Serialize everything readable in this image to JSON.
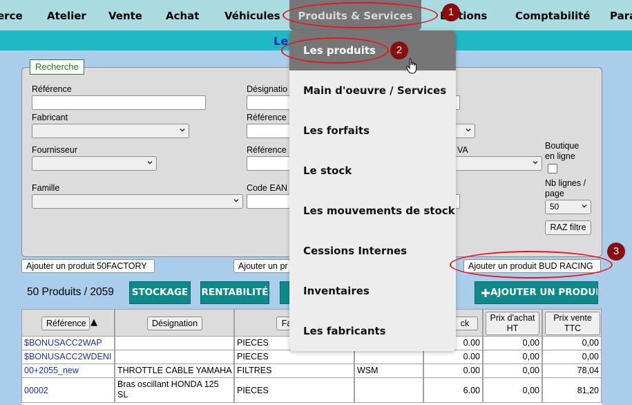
{
  "nav": {
    "items": [
      "erce",
      "Atelier",
      "Vente",
      "Achat",
      "Véhicules",
      "Produits & Services",
      "Éditions",
      "Comptabilité",
      "Para"
    ],
    "active": "Produits & Services"
  },
  "banner": {
    "title": "Le"
  },
  "dropdown": {
    "items": [
      "Les produits",
      "Main d'oeuvre / Services",
      "Les forfaits",
      "Le stock",
      "Les mouvements de stock",
      "Cessions Internes",
      "Inventaires",
      "Les fabricants"
    ],
    "highlighted": "Les produits"
  },
  "search": {
    "legend": "Recherche",
    "labels": {
      "reference": "Référence",
      "designation": "Désignatio",
      "fabricant": "Fabricant",
      "reference2": "Référence",
      "fournisseur": "Fournisseur",
      "reference3": "Référence",
      "tva": "VA",
      "famille": "Famille",
      "code_ean": "Code EAN",
      "boutique": "Boutique en ligne",
      "nb_lignes": "Nb lignes / page"
    },
    "nb_lignes_value": "50",
    "raz_label": "RAZ filtre"
  },
  "actions": {
    "add_50factory": "Ajouter un produit 50FACTORY",
    "add_partial": "Ajouter un pr",
    "add_bud_racing": "Ajouter un produit BUD RACING"
  },
  "toolbar": {
    "count": "50 Produits / 2059",
    "stockage": "STOCKAGE",
    "rentabilite": "RENTABILITÉ",
    "add_product": "AJOUTER UN PRODUIT"
  },
  "table": {
    "headers": {
      "reference": "Référence",
      "sort_indicator": "▲",
      "designation": "Désignation",
      "famille_partial": "Fa",
      "stock_partial": "ck",
      "prix_achat": "Prix d'achat HT",
      "prix_vente": "Prix vente TTC"
    },
    "rows": [
      {
        "ref": "$BONUSACC2WAP",
        "designation": "",
        "famille": "PIECES",
        "fabricant": "",
        "stock": "0.00",
        "achat": "0,00",
        "vente": "0,00"
      },
      {
        "ref": "$BONUSACC2WDENI",
        "designation": "",
        "famille": "PIECES",
        "fabricant": "",
        "stock": "0.00",
        "achat": "0,00",
        "vente": "0,00"
      },
      {
        "ref": "00+2055_new",
        "designation": "THROTTLE CABLE YAMAHA",
        "famille": "FILTRES",
        "fabricant": "WSM",
        "stock": "0.00",
        "achat": "0,00",
        "vente": "78,04"
      },
      {
        "ref": "00002",
        "designation": "Bras oscillant HONDA 125 SL",
        "famille": "PIECES",
        "fabricant": "",
        "stock": "6.00",
        "achat": "0,00",
        "vente": "81,20"
      }
    ]
  },
  "annotations": {
    "badge1": "1",
    "badge2": "2",
    "badge3": "3"
  },
  "colors": {
    "nav": "#a9dbe0",
    "banner": "#1fb9c4",
    "accent_teal": "#0f8a8a",
    "annotation_red": "#e8141b",
    "badge": "#8b0c0c",
    "link": "#1a2fd0"
  }
}
